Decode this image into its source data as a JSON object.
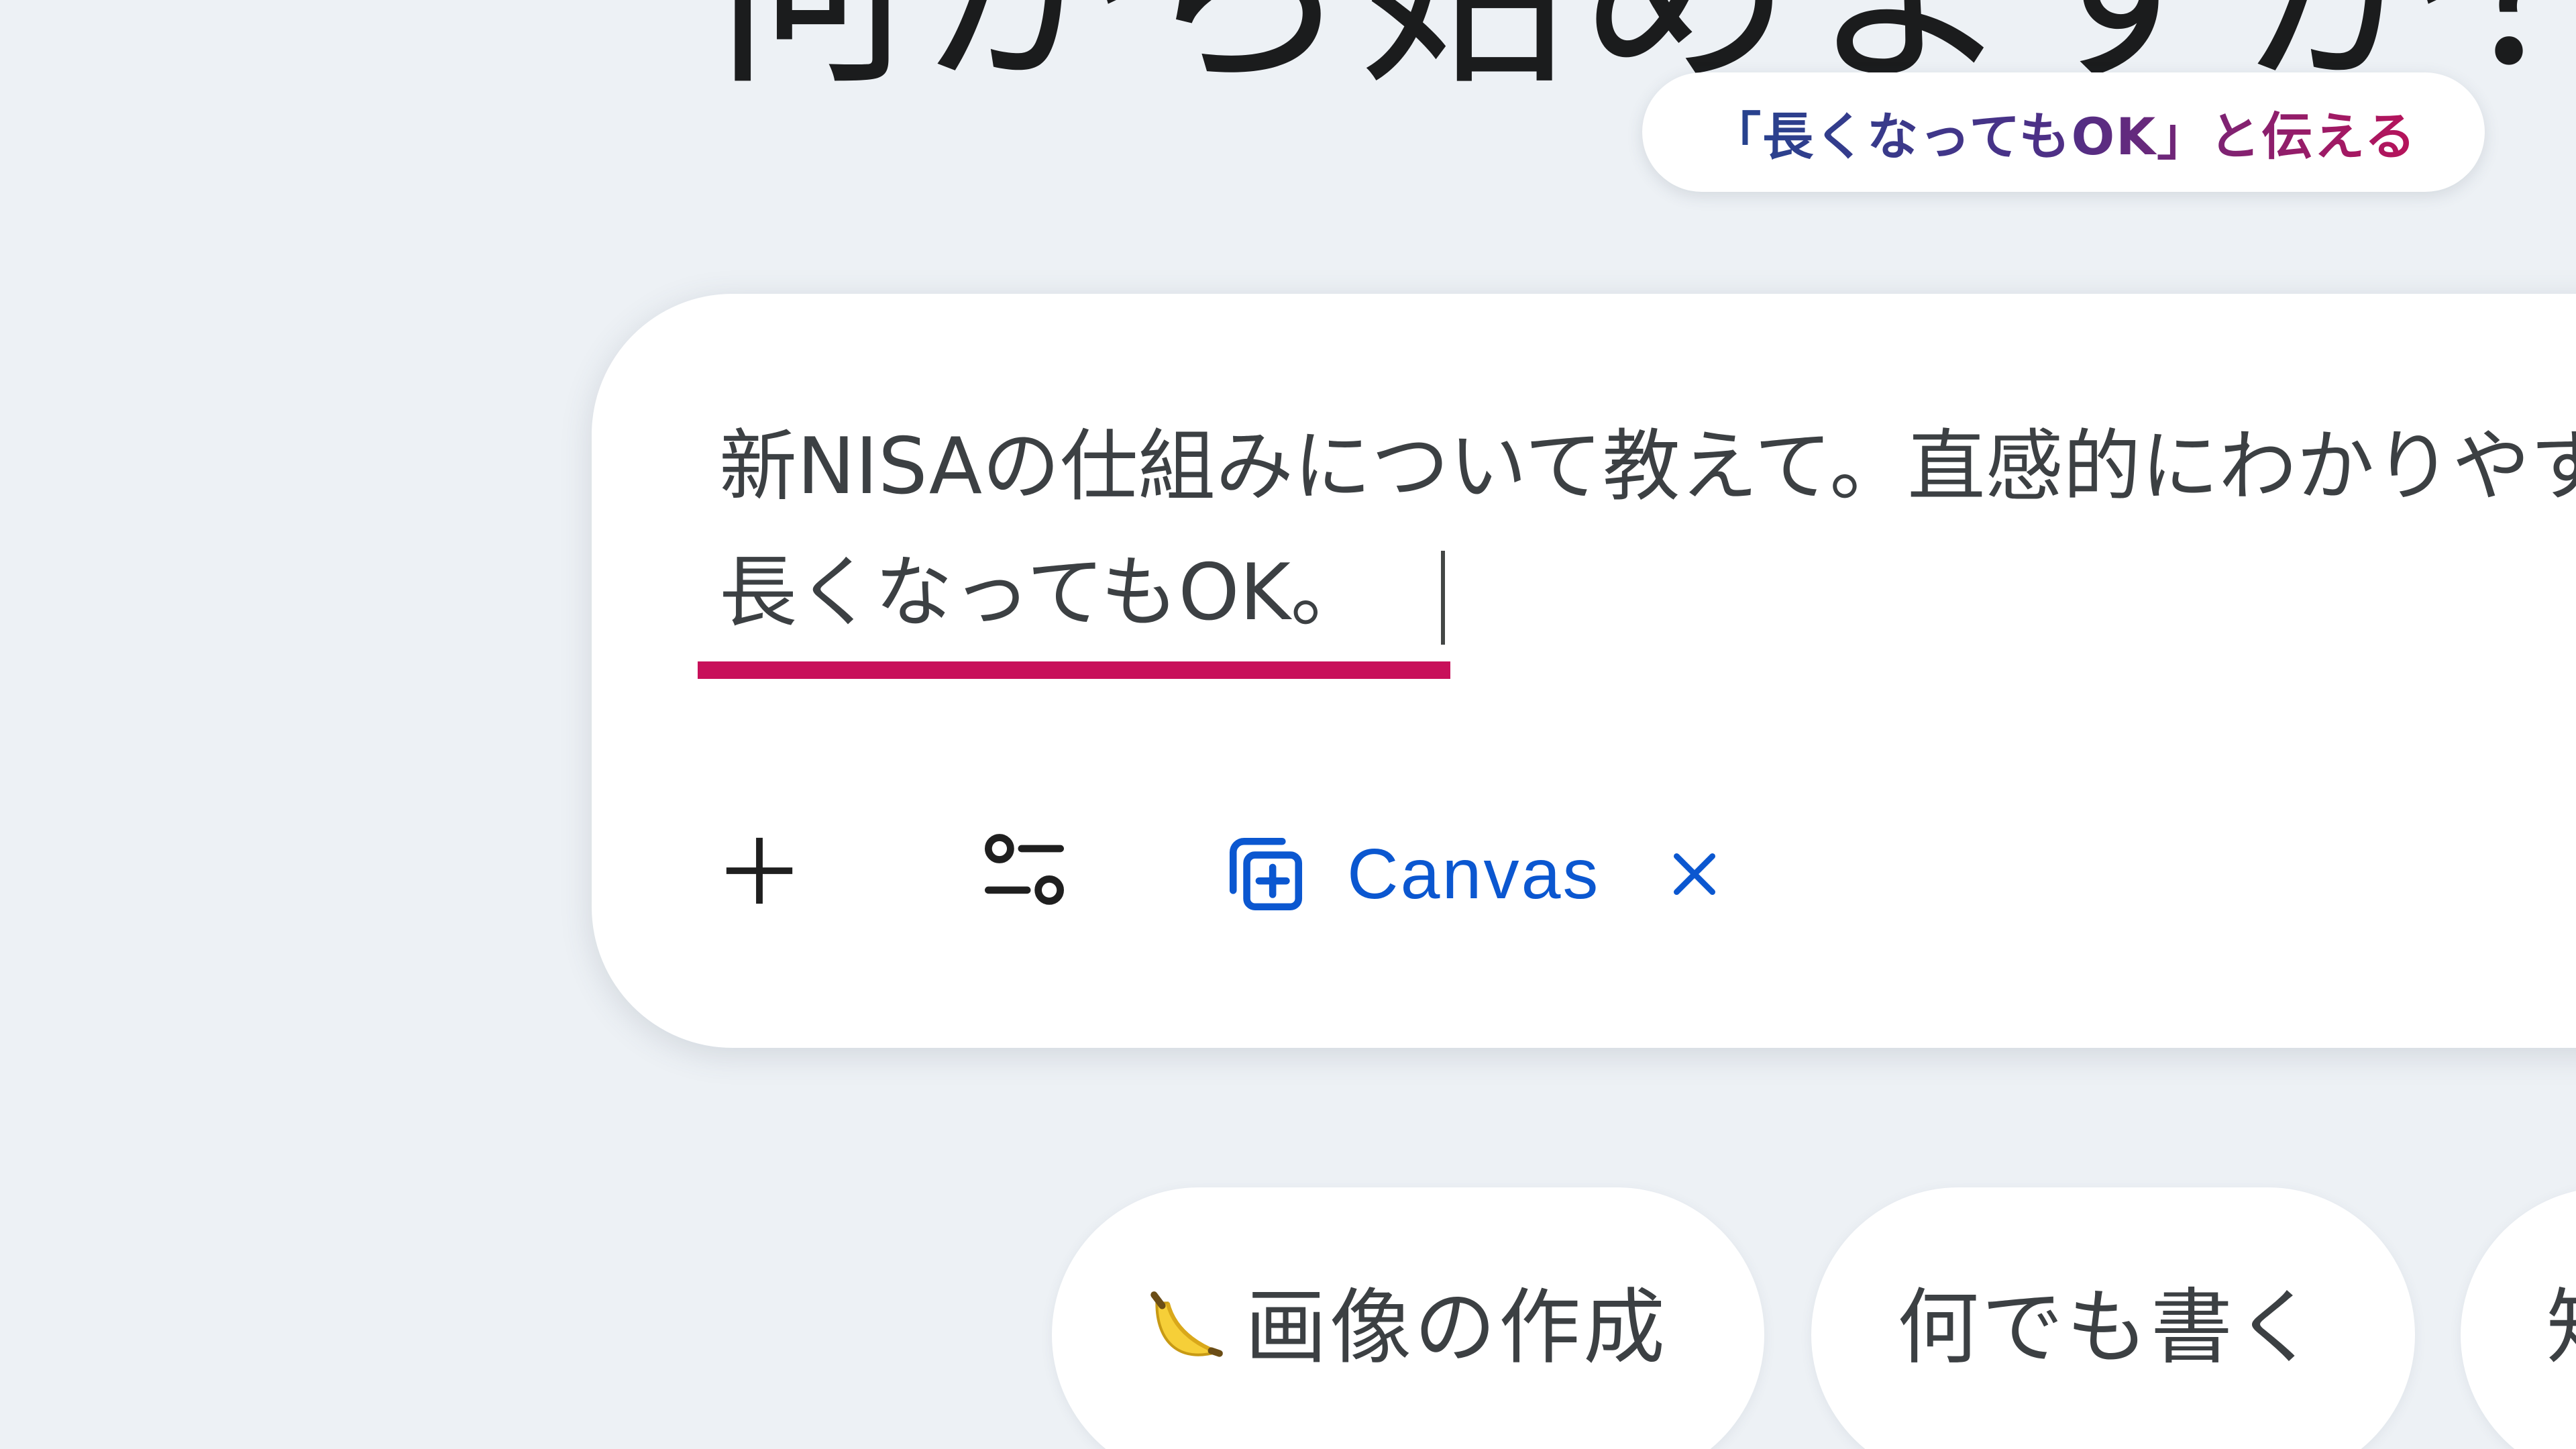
{
  "page": {
    "heading": "何から始めますか？"
  },
  "callout": {
    "text": "「長くなってもOK」と伝える"
  },
  "prompt": {
    "line1": "新NISAの仕組みについて教えて。直感的にわかりやすく、",
    "line2": "長くなってもOK。"
  },
  "toolbar": {
    "add_icon": "plus-icon",
    "tools_icon": "tune-icon",
    "canvas_label": "Canvas",
    "canvas_icon": "canvas-add-icon",
    "close_icon": "close-icon"
  },
  "suggestions": {
    "items": [
      {
        "label": "画像の作成",
        "icon": "banana-emoji"
      },
      {
        "label": "何でも書く"
      },
      {
        "label": "知"
      }
    ]
  },
  "colors": {
    "accent_blue": "#0b57d0",
    "highlight": "#c8105a",
    "callout_start": "#23448f",
    "callout_end": "#b8135a",
    "background": "#edf1f5"
  }
}
